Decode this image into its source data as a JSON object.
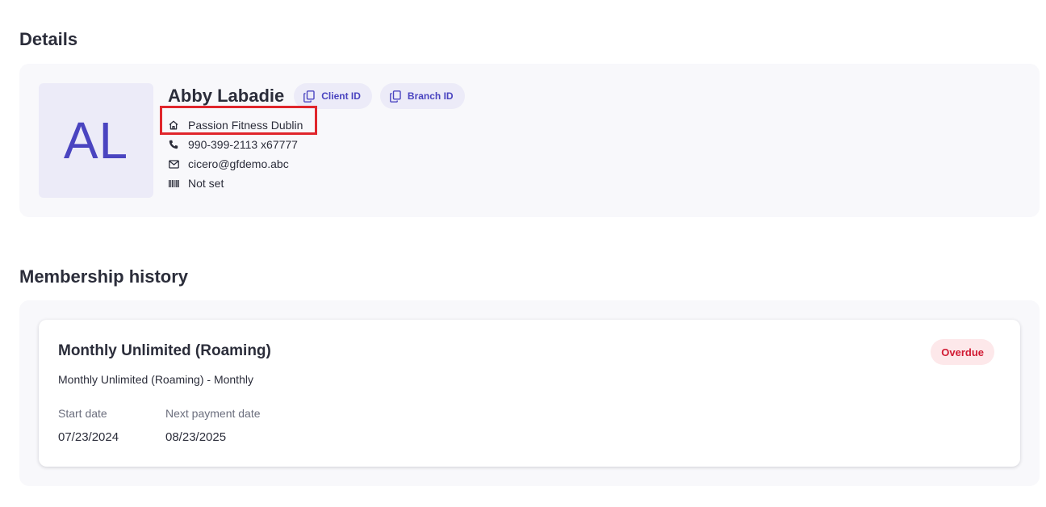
{
  "details": {
    "title": "Details",
    "avatar_initials": "AL",
    "client_name": "Abby Labadie",
    "chips": {
      "client_id": "Client ID",
      "branch_id": "Branch ID"
    },
    "info": {
      "location": "Passion Fitness Dublin",
      "phone": "990-399-2113 x67777",
      "email": "cicero@gfdemo.abc",
      "barcode": "Not set"
    },
    "icons": [
      "home-icon",
      "phone-icon",
      "mail-icon",
      "barcode-icon",
      "copy-icon"
    ],
    "highlight_color": "#e0262c"
  },
  "membership_history": {
    "title": "Membership history",
    "items": [
      {
        "plan_name": "Monthly Unlimited (Roaming)",
        "plan_sub": "Monthly Unlimited (Roaming) - Monthly",
        "status": "Overdue",
        "start_label": "Start date",
        "start_value": "07/23/2024",
        "next_payment_label": "Next payment date",
        "next_payment_value": "08/23/2025"
      }
    ]
  },
  "colors": {
    "accent": "#4a44c0",
    "accent_bg": "#ecebf8",
    "overdue_text": "#d11a33",
    "overdue_bg": "#fde8ea",
    "panel_bg": "#f8f8fb"
  }
}
